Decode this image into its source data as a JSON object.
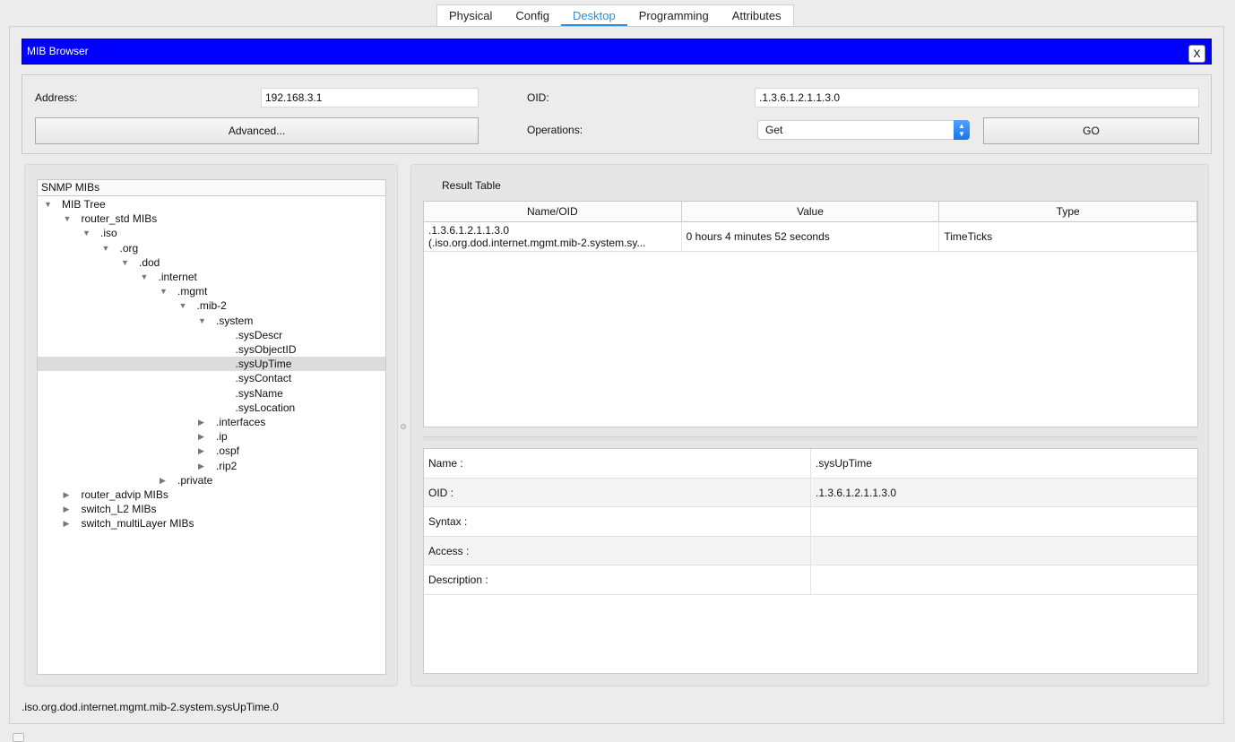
{
  "tabs": [
    "Physical",
    "Config",
    "Desktop",
    "Programming",
    "Attributes"
  ],
  "active_tab": "Desktop",
  "window": {
    "title": "MIB Browser",
    "close_label": "X"
  },
  "form": {
    "address_label": "Address:",
    "address_value": "192.168.3.1",
    "advanced_label": "Advanced...",
    "oid_label": "OID:",
    "oid_value": ".1.3.6.1.2.1.1.3.0",
    "operations_label": "Operations:",
    "operation_selected": "Get",
    "go_label": "GO"
  },
  "tree": {
    "header": "SNMP MIBs",
    "items": [
      {
        "label": "MIB Tree",
        "state": "expanded"
      },
      {
        "label": "router_std MIBs",
        "state": "expanded"
      },
      {
        "label": ".iso",
        "state": "expanded"
      },
      {
        "label": ".org",
        "state": "expanded"
      },
      {
        "label": ".dod",
        "state": "expanded"
      },
      {
        "label": ".internet",
        "state": "expanded"
      },
      {
        "label": ".mgmt",
        "state": "expanded"
      },
      {
        "label": ".mib-2",
        "state": "expanded"
      },
      {
        "label": ".system",
        "state": "expanded"
      },
      {
        "label": ".sysDescr",
        "state": "leaf"
      },
      {
        "label": ".sysObjectID",
        "state": "leaf"
      },
      {
        "label": ".sysUpTime",
        "state": "leaf",
        "selected": true
      },
      {
        "label": ".sysContact",
        "state": "leaf"
      },
      {
        "label": ".sysName",
        "state": "leaf"
      },
      {
        "label": ".sysLocation",
        "state": "leaf"
      },
      {
        "label": ".interfaces",
        "state": "collapsed"
      },
      {
        "label": ".ip",
        "state": "collapsed"
      },
      {
        "label": ".ospf",
        "state": "collapsed"
      },
      {
        "label": ".rip2",
        "state": "collapsed"
      },
      {
        "label": ".private",
        "state": "collapsed"
      },
      {
        "label": "router_advip MIBs",
        "state": "collapsed"
      },
      {
        "label": "switch_L2 MIBs",
        "state": "collapsed"
      },
      {
        "label": "switch_multiLayer MIBs",
        "state": "collapsed"
      }
    ]
  },
  "result": {
    "label": "Result Table",
    "columns": [
      "Name/OID",
      "Value",
      "Type"
    ],
    "rows": [
      {
        "name_line1": ".1.3.6.1.2.1.1.3.0",
        "name_line2": "(.iso.org.dod.internet.mgmt.mib-2.system.sy...",
        "value": "0 hours 4 minutes 52 seconds",
        "type": "TimeTicks"
      }
    ]
  },
  "details": [
    {
      "key": "Name :",
      "value": ".sysUpTime"
    },
    {
      "key": "OID :",
      "value": ".1.3.6.1.2.1.1.3.0"
    },
    {
      "key": "Syntax :",
      "value": ""
    },
    {
      "key": "Access :",
      "value": ""
    },
    {
      "key": "Description :",
      "value": ""
    }
  ],
  "status_path": ".iso.org.dod.internet.mgmt.mib-2.system.sysUpTime.0"
}
